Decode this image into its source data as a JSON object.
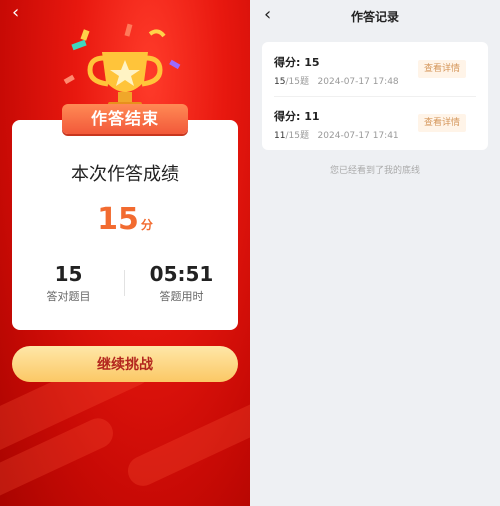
{
  "result_screen": {
    "banner": "作答结束",
    "card_title": "本次作答成绩",
    "score": "15",
    "score_unit": "分",
    "correct_count": "15",
    "correct_label": "答对题目",
    "time_used": "05:51",
    "time_label": "答题用时",
    "continue_button": "继续挑战"
  },
  "records_screen": {
    "title": "作答记录",
    "records": [
      {
        "score_label": "得分: 15",
        "correct": "15",
        "total": "/15题",
        "datetime": "2024-07-17 17:48",
        "detail_button": "查看详情"
      },
      {
        "score_label": "得分: 11",
        "correct": "11",
        "total": "/15题",
        "datetime": "2024-07-17 17:41",
        "detail_button": "查看详情"
      }
    ],
    "footer_note": "您已经看到了我的底线"
  },
  "colors": {
    "primary_red": "#e8180f",
    "score_orange": "#f26b30",
    "button_gold": "#fbc865",
    "detail_text": "#d4965a"
  },
  "icons": {
    "back": "chevron-left-icon",
    "trophy": "trophy-icon"
  }
}
